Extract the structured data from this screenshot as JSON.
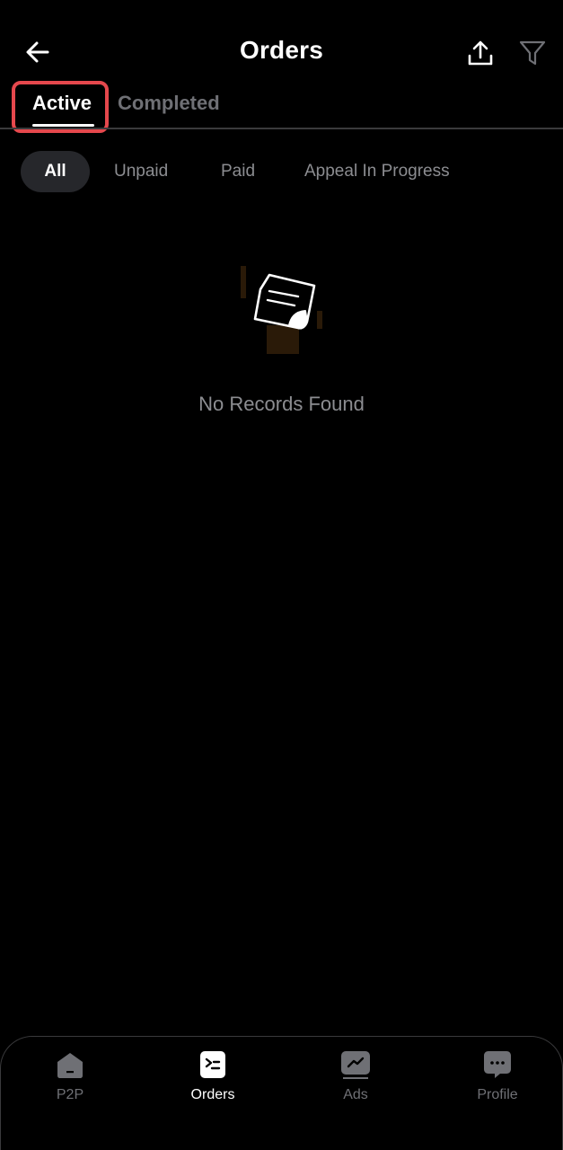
{
  "header": {
    "title": "Orders",
    "back_icon": "arrow-left-icon",
    "export_icon": "upload-icon",
    "filter_icon": "filter-icon"
  },
  "tabs": [
    {
      "label": "Active",
      "selected": true
    },
    {
      "label": "Completed",
      "selected": false
    }
  ],
  "sub_filters": [
    {
      "label": "All",
      "selected": true
    },
    {
      "label": "Unpaid",
      "selected": false
    },
    {
      "label": "Paid",
      "selected": false
    },
    {
      "label": "Appeal In Progress",
      "selected": false
    }
  ],
  "empty_state": {
    "message": "No Records Found",
    "icon": "document-note-icon"
  },
  "bottom_nav": [
    {
      "label": "P2P",
      "icon": "home-icon",
      "active": false
    },
    {
      "label": "Orders",
      "icon": "orders-icon",
      "active": true
    },
    {
      "label": "Ads",
      "icon": "ads-chart-icon",
      "active": false
    },
    {
      "label": "Profile",
      "icon": "chat-bubble-icon",
      "active": false
    }
  ],
  "colors": {
    "background": "#000000",
    "highlight_border": "#e5484d",
    "chip_bg": "#26272b",
    "muted_text": "#8c8d91",
    "inactive_text": "#6f7075"
  }
}
